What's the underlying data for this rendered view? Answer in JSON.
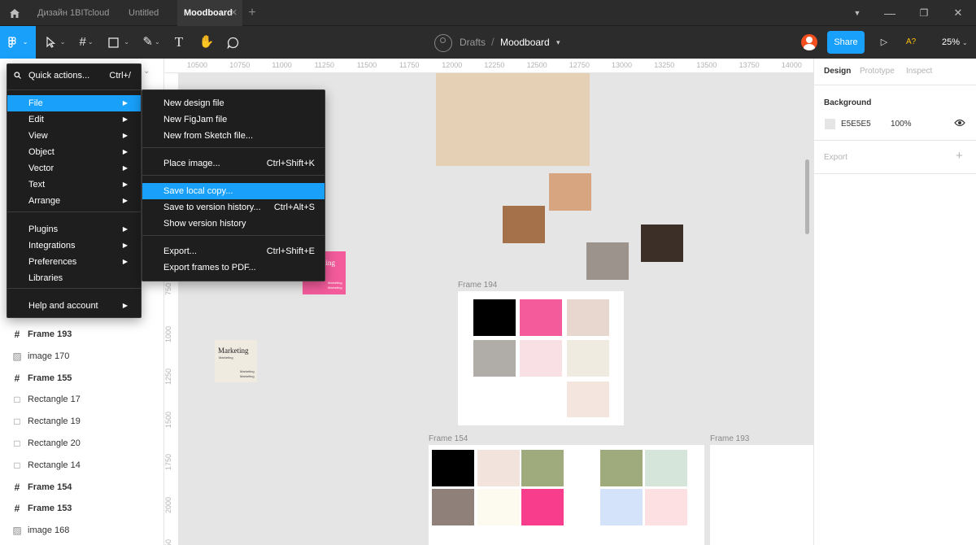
{
  "titlebar": {
    "tabs": [
      {
        "label": "Дизайн 1BITcloud"
      },
      {
        "label": "Untitled"
      },
      {
        "label": "Moodboard"
      }
    ],
    "home_icon": "home-icon",
    "close_tab_icon": "close-icon",
    "add_tab": "+"
  },
  "toolbar": {
    "breadcrumb_team": "Drafts",
    "breadcrumb_sep": "/",
    "file_name": "Moodboard",
    "share_label": "Share",
    "zoom": "25%",
    "accessibility_label": "A?",
    "brand_color": "#18a0fb",
    "avatar_color": "#f24e1e"
  },
  "main_menu": {
    "search": {
      "label": "Quick actions...",
      "shortcut": "Ctrl+/"
    },
    "items": [
      {
        "label": "File"
      },
      {
        "label": "Edit"
      },
      {
        "label": "View"
      },
      {
        "label": "Object"
      },
      {
        "label": "Vector"
      },
      {
        "label": "Text"
      },
      {
        "label": "Arrange"
      },
      {
        "label": "Plugins"
      },
      {
        "label": "Integrations"
      },
      {
        "label": "Preferences"
      },
      {
        "label": "Libraries"
      },
      {
        "label": "Help and account"
      }
    ]
  },
  "file_menu": {
    "items": [
      {
        "label": "New design file",
        "shortcut": ""
      },
      {
        "label": "New FigJam file",
        "shortcut": ""
      },
      {
        "label": "New from Sketch file...",
        "shortcut": ""
      },
      {
        "label": "Place image...",
        "shortcut": "Ctrl+Shift+K"
      },
      {
        "label": "Save local copy...",
        "shortcut": ""
      },
      {
        "label": "Save to version history...",
        "shortcut": "Ctrl+Alt+S"
      },
      {
        "label": "Show version history",
        "shortcut": ""
      },
      {
        "label": "Export...",
        "shortcut": "Ctrl+Shift+E"
      },
      {
        "label": "Export frames to PDF...",
        "shortcut": ""
      }
    ]
  },
  "layers": [
    {
      "label": "Frame 193",
      "type": "frame"
    },
    {
      "label": "image 170",
      "type": "image"
    },
    {
      "label": "Frame 155",
      "type": "frame"
    },
    {
      "label": "Rectangle 17",
      "type": "rectangle"
    },
    {
      "label": "Rectangle 19",
      "type": "rectangle"
    },
    {
      "label": "Rectangle 20",
      "type": "rectangle"
    },
    {
      "label": "Rectangle 14",
      "type": "rectangle"
    },
    {
      "label": "Frame 154",
      "type": "frame"
    },
    {
      "label": "Frame 153",
      "type": "frame"
    },
    {
      "label": "image 168",
      "type": "image"
    }
  ],
  "canvas": {
    "ruler_top": [
      "10500",
      "10750",
      "11000",
      "11250",
      "11500",
      "11750",
      "12000",
      "12250",
      "12500",
      "12750",
      "13000",
      "13250",
      "13500",
      "13750",
      "14000"
    ],
    "ruler_left": [
      "750",
      "1000",
      "1250",
      "1500",
      "1750",
      "2000",
      "2250"
    ],
    "frame_194_label": "Frame 194",
    "frame_154_label": "Frame 154",
    "frame_193_label": "Frame 193",
    "card_title": "Marketing",
    "card_sub": "Marketing",
    "card_note1": "Marketing",
    "card_note2": "Marketing",
    "pink_card_title": "eting",
    "pink_card_note1": "Marketing",
    "pink_card_note2": "Marketing",
    "swatches_loose": [
      "#e5cfb5",
      "#d7a57f",
      "#a5714b",
      "#9c948c",
      "#3b2f27"
    ],
    "frame_194_swatches": [
      "#000000",
      "#f35b9b",
      "#e8d7cf",
      "#b0aca8",
      "#f8e0e4",
      "#efebe0",
      "#f4e6de"
    ],
    "frame_154_swatches": [
      "#000000",
      "#f2e4dc",
      "#9fab7d",
      "#9fab7d",
      "#d5e5d9",
      "#8f817a",
      "#fdfaf0",
      "#f73d8c",
      "#d4e2fa",
      "#fde1e2"
    ]
  },
  "right_panel": {
    "tabs": [
      {
        "label": "Design"
      },
      {
        "label": "Prototype"
      },
      {
        "label": "Inspect"
      }
    ],
    "background_title": "Background",
    "background_hex": "E5E5E5",
    "background_opacity": "100%",
    "export_title": "Export",
    "export_add": "+"
  }
}
